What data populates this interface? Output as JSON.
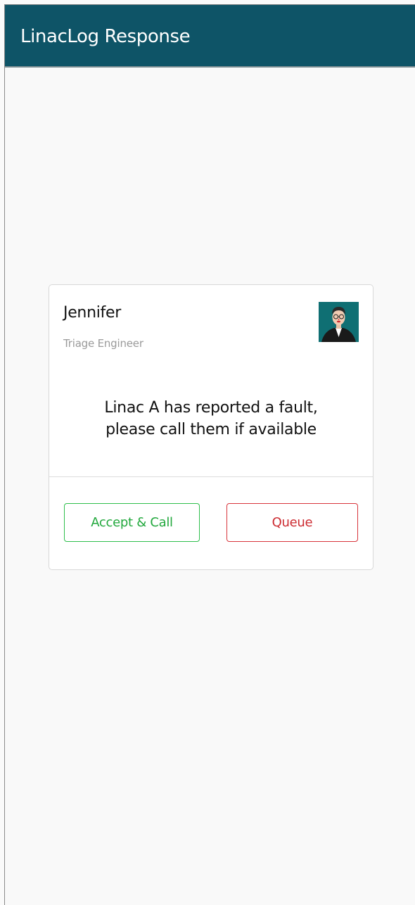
{
  "app": {
    "title": "LinacLog Response"
  },
  "card": {
    "name": "Jennifer",
    "role": "Triage Engineer",
    "message_line1": "Linac A has reported a fault,",
    "message_line2": "please call them if available",
    "accept_label": "Accept & Call",
    "queue_label": "Queue"
  },
  "colors": {
    "header_bg": "#0e5467",
    "accept": "#22a83d",
    "queue": "#cc2a30"
  },
  "icons": {
    "avatar": "profile-photo"
  }
}
